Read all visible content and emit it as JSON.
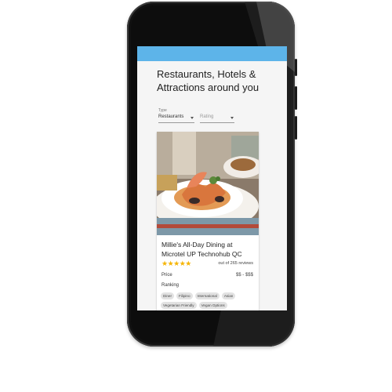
{
  "page": {
    "title": "Restaurants, Hotels & Attractions around you",
    "accent_color": "#5db4e9"
  },
  "filters": {
    "type_label": "Type",
    "type_value": "Restaurants",
    "rating_placeholder": "Rating"
  },
  "listing": {
    "name": "Millie's All-Day Dining at Microtel UP Technohub QC",
    "rating": 5,
    "stars": "★★★★★",
    "reviews_text": "out of 265 reviews",
    "price_label": "Price",
    "price_value": "$$ - $$$",
    "ranking_label": "Ranking",
    "tags": [
      "Diner",
      "Filipino",
      "International",
      "Asian",
      "Vegetarian Friendly",
      "Vegan Options"
    ],
    "star_color": "#f5b400"
  },
  "icons": [
    "dropdown-arrow-icon",
    "star-icon"
  ]
}
